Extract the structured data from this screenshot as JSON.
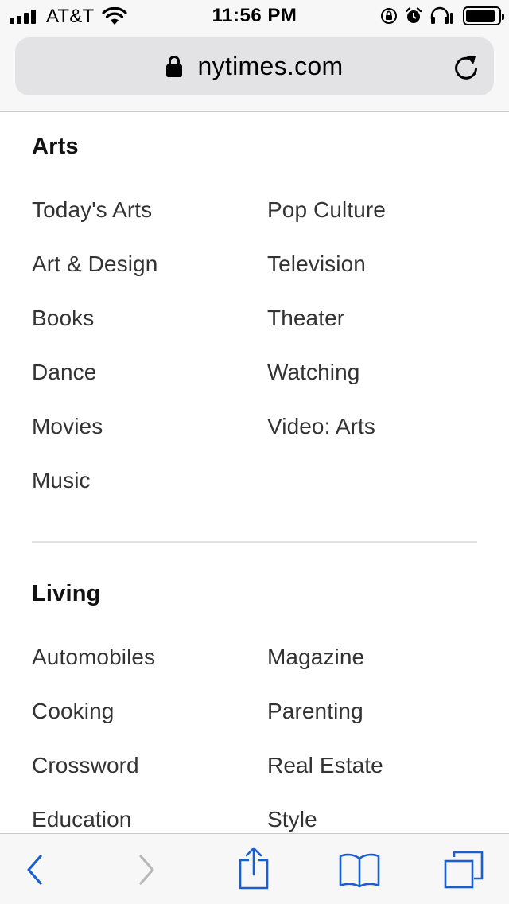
{
  "status_bar": {
    "carrier": "AT&T",
    "time": "11:56 PM",
    "battery_level": 0.9
  },
  "address_bar": {
    "url": "nytimes.com"
  },
  "sections": [
    {
      "title": "Arts",
      "links": [
        "Today's Arts",
        "Pop Culture",
        "Art & Design",
        "Television",
        "Books",
        "Theater",
        "Dance",
        "Watching",
        "Movies",
        "Video: Arts",
        "Music"
      ]
    },
    {
      "title": "Living",
      "links": [
        "Automobiles",
        "Magazine",
        "Cooking",
        "Parenting",
        "Crossword",
        "Real Estate",
        "Education",
        "Style"
      ]
    }
  ],
  "colors": {
    "toolbar_active": "#1a5fd1",
    "toolbar_disabled": "#b8b8b8",
    "link_text": "#333333",
    "heading_text": "#121212"
  },
  "icons": {
    "back": "chevron-left-icon",
    "forward": "chevron-right-icon",
    "share": "share-icon",
    "bookmarks": "open-book-icon",
    "tabs": "tabs-icon",
    "lock": "lock-icon",
    "reload": "reload-icon"
  }
}
